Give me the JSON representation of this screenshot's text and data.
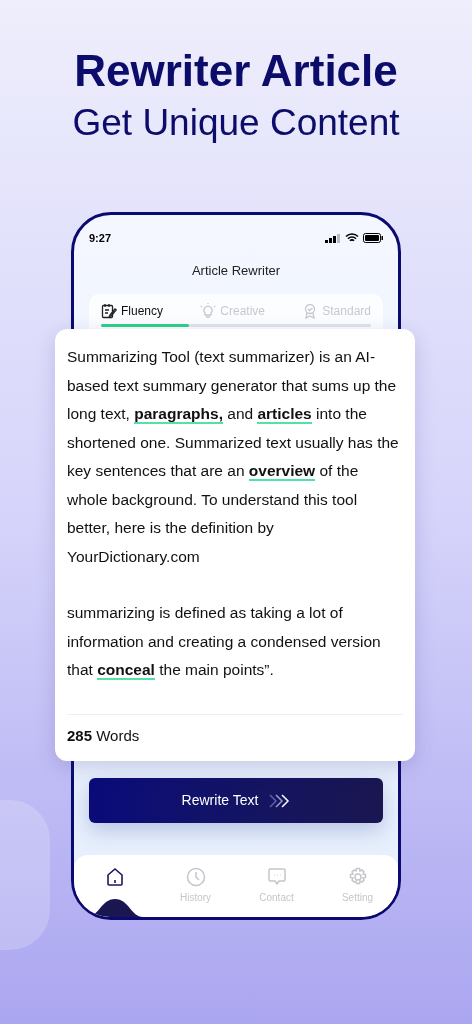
{
  "headline": {
    "title": "Rewriter Article",
    "subtitle": "Get Unique Content"
  },
  "status_bar": {
    "time": "9:27"
  },
  "app_title": "Article Rewriter",
  "modes": [
    {
      "label": "Fluency",
      "selected": true
    },
    {
      "label": "Creative",
      "selected": false
    },
    {
      "label": "Standard",
      "selected": false
    }
  ],
  "article": {
    "paragraphs": [
      "Summarizing Tool (text summarizer) is an AI-based text summary generator that sums up the long text, **paragraphs,** and **articles** into the shortened one. Summarized text usually has the key sentences that are an **overview** of the whole background. To understand this tool better, here is the definition by YourDictionary.com",
      "summarizing is defined as taking a lot of information and creating a condensed version that **conceal** the main points”."
    ],
    "word_count": "**285** Words"
  },
  "button": "Rewrite Text",
  "nav": [
    {
      "selected": true
    },
    {
      "label": "History",
      "selected": false
    },
    {
      "label": "Contact",
      "selected": false
    },
    {
      "label": "Setting",
      "selected": false
    }
  ]
}
